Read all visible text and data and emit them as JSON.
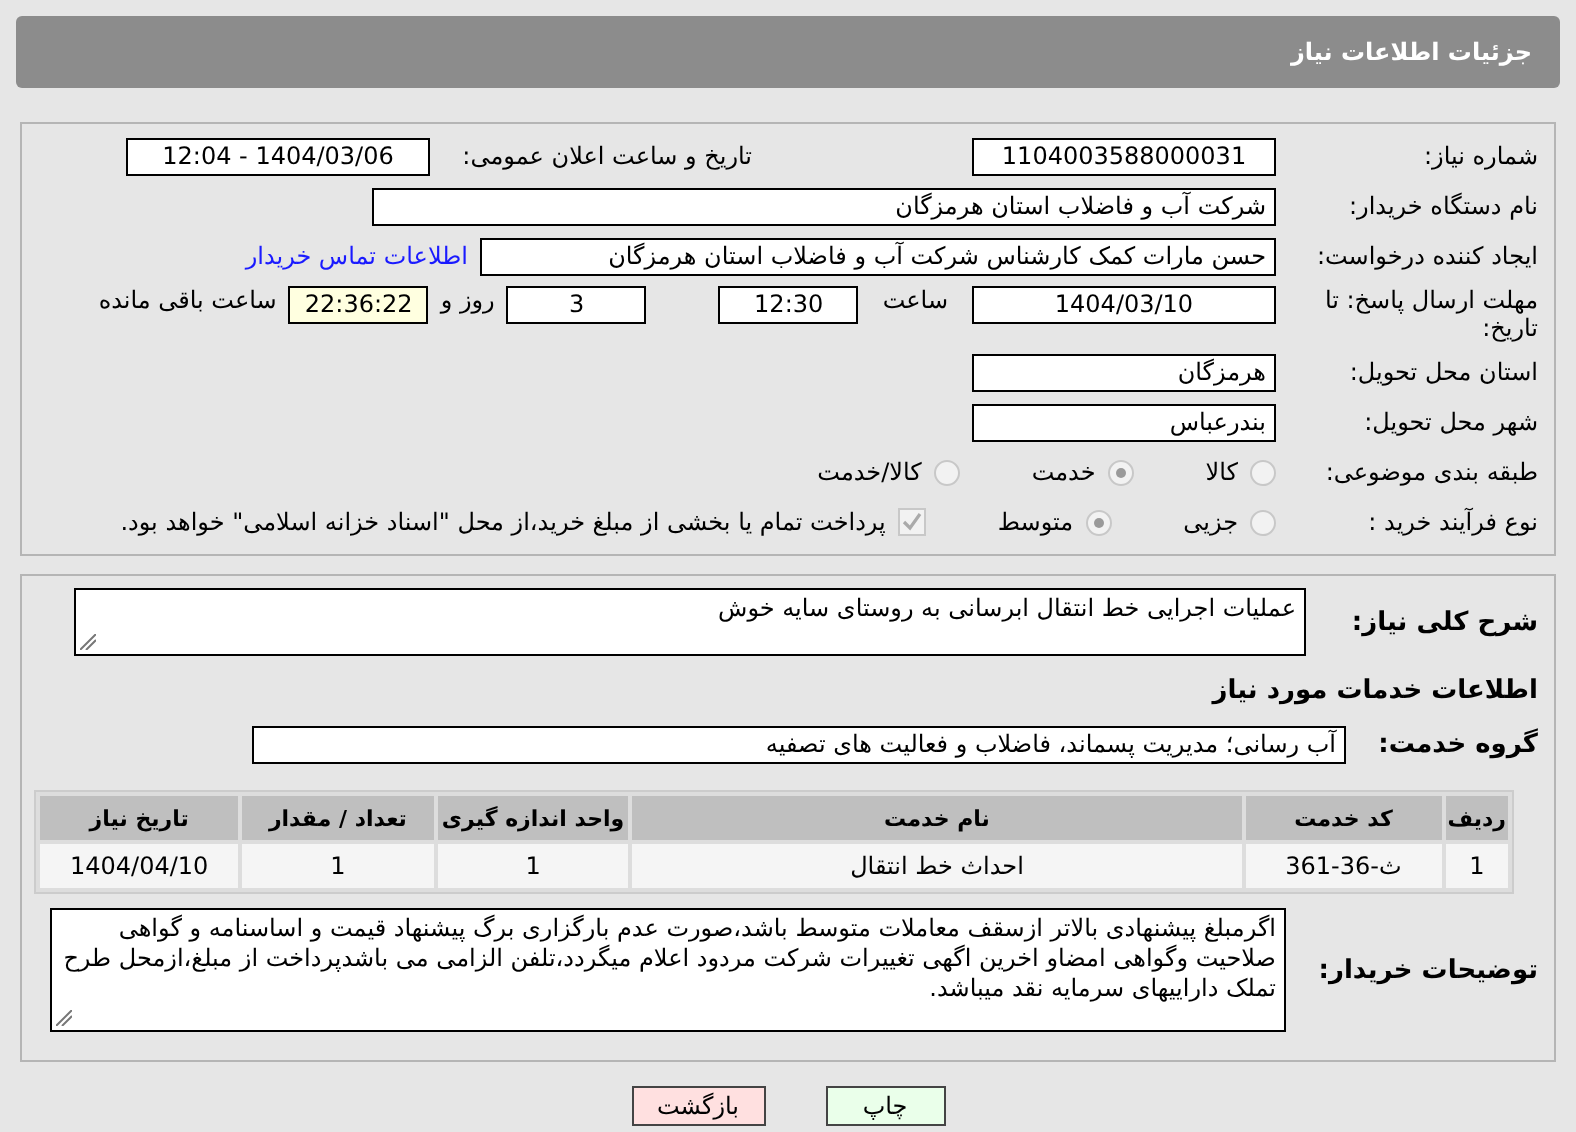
{
  "title": "جزئیات اطلاعات نیاز",
  "need_number": {
    "label": "شماره نیاز:",
    "value": "1104003588000031"
  },
  "announce": {
    "label": "تاریخ و ساعت اعلان عمومی:",
    "value": "1404/03/06 - 12:04"
  },
  "buyer": {
    "label": "نام دستگاه خریدار:",
    "value": "شرکت آب و فاضلاب استان هرمزگان"
  },
  "creator": {
    "label": "ایجاد کننده درخواست:",
    "value": "حسن مارات کمک کارشناس شرکت آب و فاضلاب استان هرمزگان",
    "link": "اطلاعات تماس خریدار"
  },
  "deadline": {
    "label": "مهلت ارسال پاسخ: تا تاریخ:",
    "date": "1404/03/10",
    "time_label": "ساعت",
    "time": "12:30",
    "days": "3",
    "days_label": "روز و",
    "remaining": "22:36:22",
    "remaining_label": "ساعت باقی مانده"
  },
  "province": {
    "label": "استان محل تحویل:",
    "value": "هرمزگان"
  },
  "city": {
    "label": "شهر محل تحویل:",
    "value": "بندرعباس"
  },
  "category": {
    "label": "طبقه بندی موضوعی:",
    "options": [
      {
        "label": "کالا",
        "selected": false
      },
      {
        "label": "خدمت",
        "selected": true
      },
      {
        "label": "کالا/خدمت",
        "selected": false
      }
    ]
  },
  "process": {
    "label": "نوع فرآیند خرید :",
    "options": [
      {
        "label": "جزیی",
        "selected": false
      },
      {
        "label": "متوسط",
        "selected": true
      }
    ],
    "payment": {
      "checked": true,
      "label": "پرداخت تمام یا بخشی از مبلغ خرید،از محل \"اسناد خزانه اسلامی\" خواهد بود."
    }
  },
  "summary": {
    "label": "شرح کلی نیاز:",
    "value": "عملیات اجرایی خط انتقال ابرسانی به روستای سایه خوش"
  },
  "services_heading": "اطلاعات خدمات مورد نیاز",
  "service_group": {
    "label": "گروه خدمت:",
    "value": "آب رسانی؛ مدیریت پسماند، فاضلاب و فعالیت های تصفیه"
  },
  "table": {
    "columns": [
      "ردیف",
      "کد خدمت",
      "نام خدمت",
      "واحد اندازه گیری",
      "تعداد / مقدار",
      "تاریخ نیاز"
    ],
    "rows": [
      [
        "1",
        "ث-36-361",
        "احداث خط انتقال",
        "1",
        "1",
        "1404/04/10"
      ]
    ]
  },
  "notes": {
    "label": "توضیحات خریدار:",
    "value": "اگرمبلغ پیشنهادی بالاتر ازسقف معاملات متوسط باشد،صورت عدم بارگزاری برگ پیشنهاد قیمت و اساسنامه و گواهی صلاحیت وگواهی امضاو اخرین اگهی تغییرات شرکت مردود اعلام میگردد،تلفن الزامی می باشدپرداخت از مبلغ،ازمحل طرح تملک داراییهای سرمایه نقد میباشد."
  },
  "buttons": [
    {
      "label": "چاپ",
      "kind": "print"
    },
    {
      "label": "بازگشت",
      "kind": "back"
    }
  ]
}
